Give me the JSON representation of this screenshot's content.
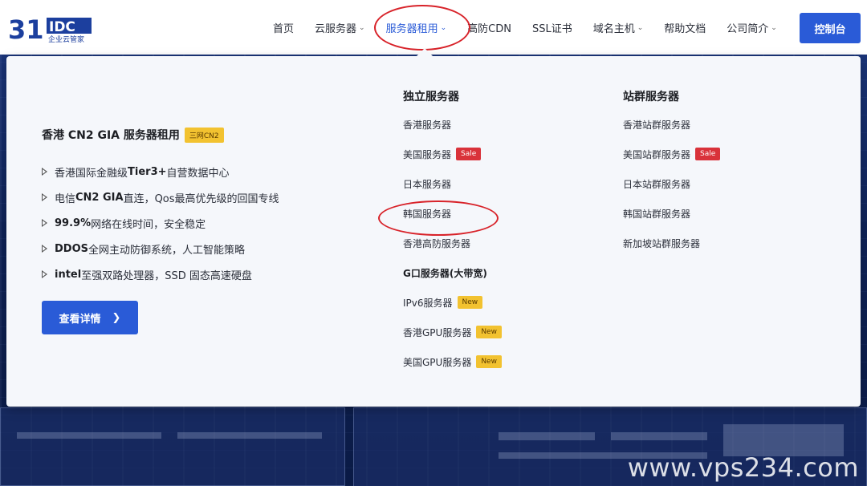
{
  "logo": {
    "mark": "31",
    "brand": "IDC",
    "tagline": "企业云管家"
  },
  "nav": {
    "items": [
      {
        "label": "首页",
        "has_chevron": false
      },
      {
        "label": "云服务器",
        "has_chevron": true
      },
      {
        "label": "服务器租用",
        "has_chevron": true,
        "active": true
      },
      {
        "label": "高防CDN",
        "has_chevron": false
      },
      {
        "label": "SSL证书",
        "has_chevron": false
      },
      {
        "label": "域名主机",
        "has_chevron": true
      },
      {
        "label": "帮助文档",
        "has_chevron": false
      },
      {
        "label": "公司简介",
        "has_chevron": true
      }
    ],
    "console_label": "控制台"
  },
  "promo": {
    "title": "香港 CN2 GIA 服务器租用",
    "tag": "三网CN2",
    "features": [
      {
        "pre": "香港国际金融级 ",
        "bold": "Tier3+",
        "post": " 自营数据中心"
      },
      {
        "pre": "电信 ",
        "bold": "CN2 GIA",
        "post": " 直连，Qos最高优先级的回国专线"
      },
      {
        "pre": "",
        "bold": "99.9%",
        "post": " 网络在线时间，安全稳定"
      },
      {
        "pre": "",
        "bold": "DDOS",
        "post": " 全网主动防御系统，人工智能策略"
      },
      {
        "pre": "",
        "bold": "intel",
        "post": "至强双路处理器，SSD 固态高速硬盘"
      }
    ],
    "detail_button": "查看详情"
  },
  "dedicated": {
    "title": "独立服务器",
    "items": [
      {
        "label": "香港服务器",
        "badge": ""
      },
      {
        "label": "美国服务器",
        "badge": "Sale"
      },
      {
        "label": "日本服务器",
        "badge": ""
      },
      {
        "label": "韩国服务器",
        "badge": ""
      },
      {
        "label": "香港高防服务器",
        "badge": ""
      },
      {
        "label": "G口服务器(大带宽)",
        "badge": ""
      },
      {
        "label": "IPv6服务器",
        "badge": "New"
      },
      {
        "label": "香港GPU服务器",
        "badge": "New"
      },
      {
        "label": "美国GPU服务器",
        "badge": "New"
      }
    ]
  },
  "cluster": {
    "title": "站群服务器",
    "items": [
      {
        "label": "香港站群服务器",
        "badge": ""
      },
      {
        "label": "美国站群服务器",
        "badge": "Sale"
      },
      {
        "label": "日本站群服务器",
        "badge": ""
      },
      {
        "label": "韩国站群服务器",
        "badge": ""
      },
      {
        "label": "新加坡站群服务器",
        "badge": ""
      }
    ]
  },
  "watermark": "www.vps234.com",
  "colors": {
    "accent": "#2a5bd7",
    "annotation": "#d8232a",
    "sale": "#d9323a",
    "new": "#f2c230"
  }
}
